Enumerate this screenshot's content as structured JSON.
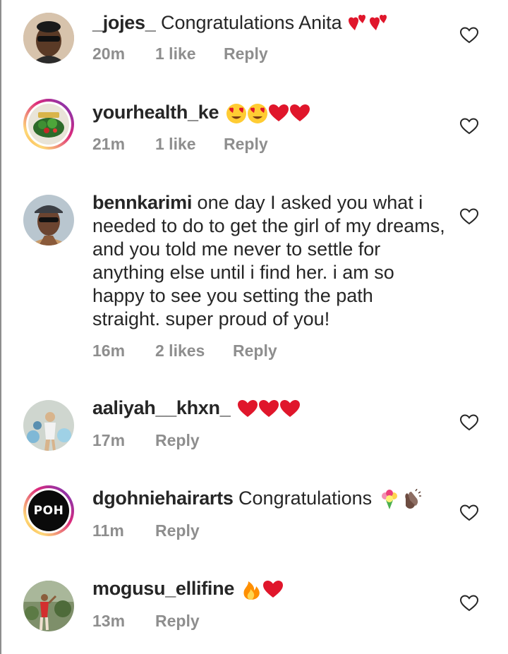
{
  "comments": [
    {
      "username": "_jojes_",
      "text": " Congratulations Anita ",
      "emojis": [
        "two-hearts",
        "two-hearts"
      ],
      "time": "20m",
      "likes": "1 like",
      "reply": "Reply",
      "avatar": "person-sunglasses"
    },
    {
      "username": "yourhealth_ke",
      "text": " ",
      "emojis": [
        "heart-eyes",
        "heart-eyes",
        "red-heart",
        "red-heart"
      ],
      "time": "21m",
      "likes": "1 like",
      "reply": "Reply",
      "avatar": "salad-bowl",
      "story_ring": true
    },
    {
      "username": "bennkarimi",
      "text": " one day I asked you what i needed to do to get the girl of my dreams, and you told me never to settle for anything else until i find her. i am so happy to see you setting the path straight. super proud of you!",
      "emojis": [],
      "time": "16m",
      "likes": "2 likes",
      "reply": "Reply",
      "avatar": "person-cap"
    },
    {
      "username": "aaliyah__khxn_",
      "text": " ",
      "emojis": [
        "red-heart",
        "red-heart",
        "red-heart"
      ],
      "time": "17m",
      "likes": "",
      "reply": "Reply",
      "avatar": "person-balloons"
    },
    {
      "username": "dgohniehairarts",
      "text": " Congratulations ",
      "emojis": [
        "bouquet",
        "clapping-hands"
      ],
      "time": "11m",
      "likes": "",
      "reply": "Reply",
      "avatar": "logo",
      "logo_text": "POH",
      "story_ring": true
    },
    {
      "username": "mogusu_ellifine",
      "text": " ",
      "emojis": [
        "fire",
        "red-heart"
      ],
      "time": "13m",
      "likes": "",
      "reply": "Reply",
      "avatar": "person-garden"
    }
  ],
  "colors": {
    "text": "#262626",
    "meta": "#8e8e8e",
    "heart": "#e0162b"
  }
}
